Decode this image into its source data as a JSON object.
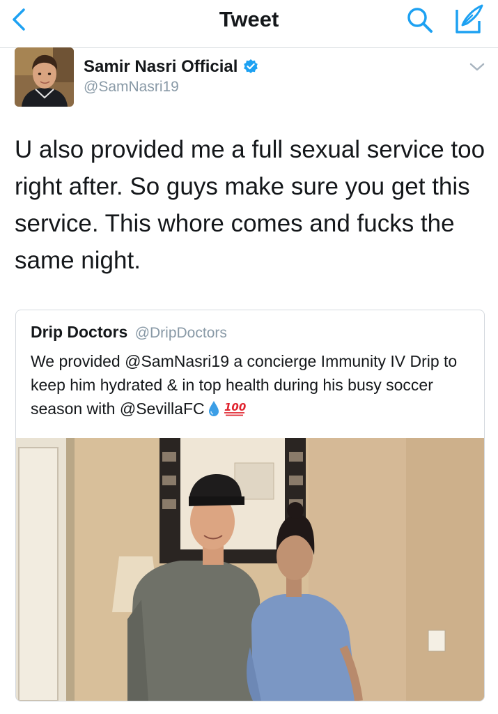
{
  "nav": {
    "title": "Tweet",
    "back_icon": "chevron-left-icon",
    "search_icon": "search-icon",
    "compose_icon": "compose-icon",
    "accent_color": "#1da1f2"
  },
  "tweet": {
    "author_name": "Samir Nasri Official",
    "author_handle": "@SamNasri19",
    "verified": true,
    "text": "U also provided me a full sexual service too right after. So guys make sure you get this service. This whore comes and fucks the same night.",
    "menu_icon": "chevron-down-icon"
  },
  "quoted_tweet": {
    "author_name": "Drip Doctors",
    "author_handle": "@DripDoctors",
    "text": "We provided @SamNasri19 a concierge Immunity IV Drip to keep him hydrated & in top health during his busy soccer season with @SevillaFC",
    "emoji": [
      "droplet-icon",
      "hundred-points-icon"
    ],
    "photo_text": "",
    "emoji_text": "100"
  }
}
